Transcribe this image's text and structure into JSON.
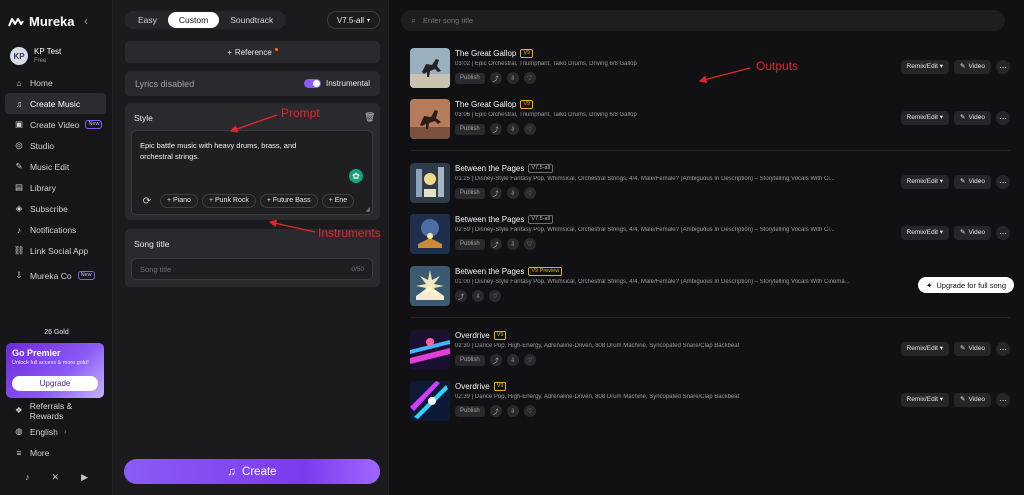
{
  "app": {
    "name": "Mureka"
  },
  "user": {
    "initials": "KP",
    "name": "KP Test",
    "plan": "Free"
  },
  "nav": [
    {
      "label": "Home",
      "icon": "home-icon"
    },
    {
      "label": "Create Music",
      "icon": "music-note-icon",
      "active": true
    },
    {
      "label": "Create Video",
      "icon": "video-icon",
      "badge": "New"
    },
    {
      "label": "Studio",
      "icon": "studio-icon"
    },
    {
      "label": "Music Edit",
      "icon": "edit-icon"
    },
    {
      "label": "Library",
      "icon": "library-icon"
    },
    {
      "label": "Subscribe",
      "icon": "subscribe-icon"
    },
    {
      "label": "Notifications",
      "icon": "bell-icon"
    },
    {
      "label": "Link Social App",
      "icon": "link-icon"
    },
    {
      "label": "Mureka Co",
      "icon": "download-icon",
      "badge": "New"
    }
  ],
  "gold": "26 Gold",
  "premier": {
    "title": "Go Premier",
    "subtitle": "Unlock full access & more gold!",
    "button": "Upgrade"
  },
  "bottom_nav": [
    {
      "label": "Referrals & Rewards",
      "icon": "gift-icon"
    },
    {
      "label": "English",
      "icon": "globe-icon"
    },
    {
      "label": "More",
      "icon": "menu-icon"
    }
  ],
  "socials": [
    "tiktok-icon",
    "x-icon",
    "youtube-icon"
  ],
  "panel": {
    "modes": [
      "Easy",
      "Custom",
      "Soundtrack"
    ],
    "active_mode": "Custom",
    "version": "V7.5-all",
    "reference": "Reference",
    "lyrics_label": "Lyrics disabled",
    "instrumental_label": "Instrumental",
    "instrumental_on": true,
    "style_label": "Style",
    "style_text": "Epic battle music with heavy drums, brass, and orchestral strings.",
    "chips": [
      "Piano",
      "Punk Rock",
      "Future Bass",
      "Ene"
    ],
    "song_title_label": "Song title",
    "song_title_placeholder": "Song title",
    "song_title_count": "0/50",
    "create_label": "Create"
  },
  "search": {
    "placeholder": "Enter song title"
  },
  "songs": [
    {
      "title": "The Great Gallop",
      "version": "V9",
      "desc": "03:02 | Epic Orchestral, Triumphant, Taiko Drums, Driving 6/8 Gallop",
      "publish": "Publish",
      "remix": "Remix/Edit",
      "video": "Video"
    },
    {
      "title": "The Great Gallop",
      "version": "V9",
      "desc": "03:06 | Epic Orchestral, Triumphant, Taiko Drums, Driving 6/8 Gallop",
      "publish": "Publish",
      "remix": "Remix/Edit",
      "video": "Video"
    },
    {
      "title": "Between the Pages",
      "version": "V7.5-all",
      "desc": "01:25 | Disney-Style Fantasy Pop, Whimsical, Orchestral Strings, 4/4, Male/Female? (Ambiguous In Description) – Storytelling Vocals With Ci...",
      "publish": "Publish",
      "remix": "Remix/Edit",
      "video": "Video"
    },
    {
      "title": "Between the Pages",
      "version": "V7.5-all",
      "desc": "02:59 | Disney-Style Fantasy Pop, Whimsical, Orchestral Strings, 4/4, Male/Female? (Ambiguous In Description) – Storytelling Vocals With Ci...",
      "publish": "Publish",
      "remix": "Remix/Edit",
      "video": "Video"
    },
    {
      "title": "Between the Pages",
      "version": "V9 Preview",
      "desc": "01:00 | Disney-Style Fantasy Pop, Whimsical, Orchestral Strings, 4/4, Male/Female? (Ambiguous In Description) – Storytelling Vocals With Cinema...",
      "upgrade": "Upgrade for full song"
    },
    {
      "title": "Overdrive",
      "version": "V9",
      "desc": "02:30 | Dance Pop, High-Energy, Adrenaline-Driven, 808 Drum Machine, Syncopated Snare/Clap Backbeat",
      "publish": "Publish",
      "remix": "Remix/Edit",
      "video": "Video"
    },
    {
      "title": "Overdrive",
      "version": "V9",
      "desc": "02:39 | Dance Pop, High-Energy, Adrenaline-Driven, 808 Drum Machine, Syncopated Snare/Clap Backbeat",
      "publish": "Publish",
      "remix": "Remix/Edit",
      "video": "Video"
    }
  ],
  "annotations": {
    "prompt": "Prompt",
    "instruments": "Instruments",
    "outputs": "Outputs"
  },
  "colors": {
    "accent": "#8b5cf6",
    "annotation": "#e3262b",
    "version_badge": "#eab308"
  }
}
